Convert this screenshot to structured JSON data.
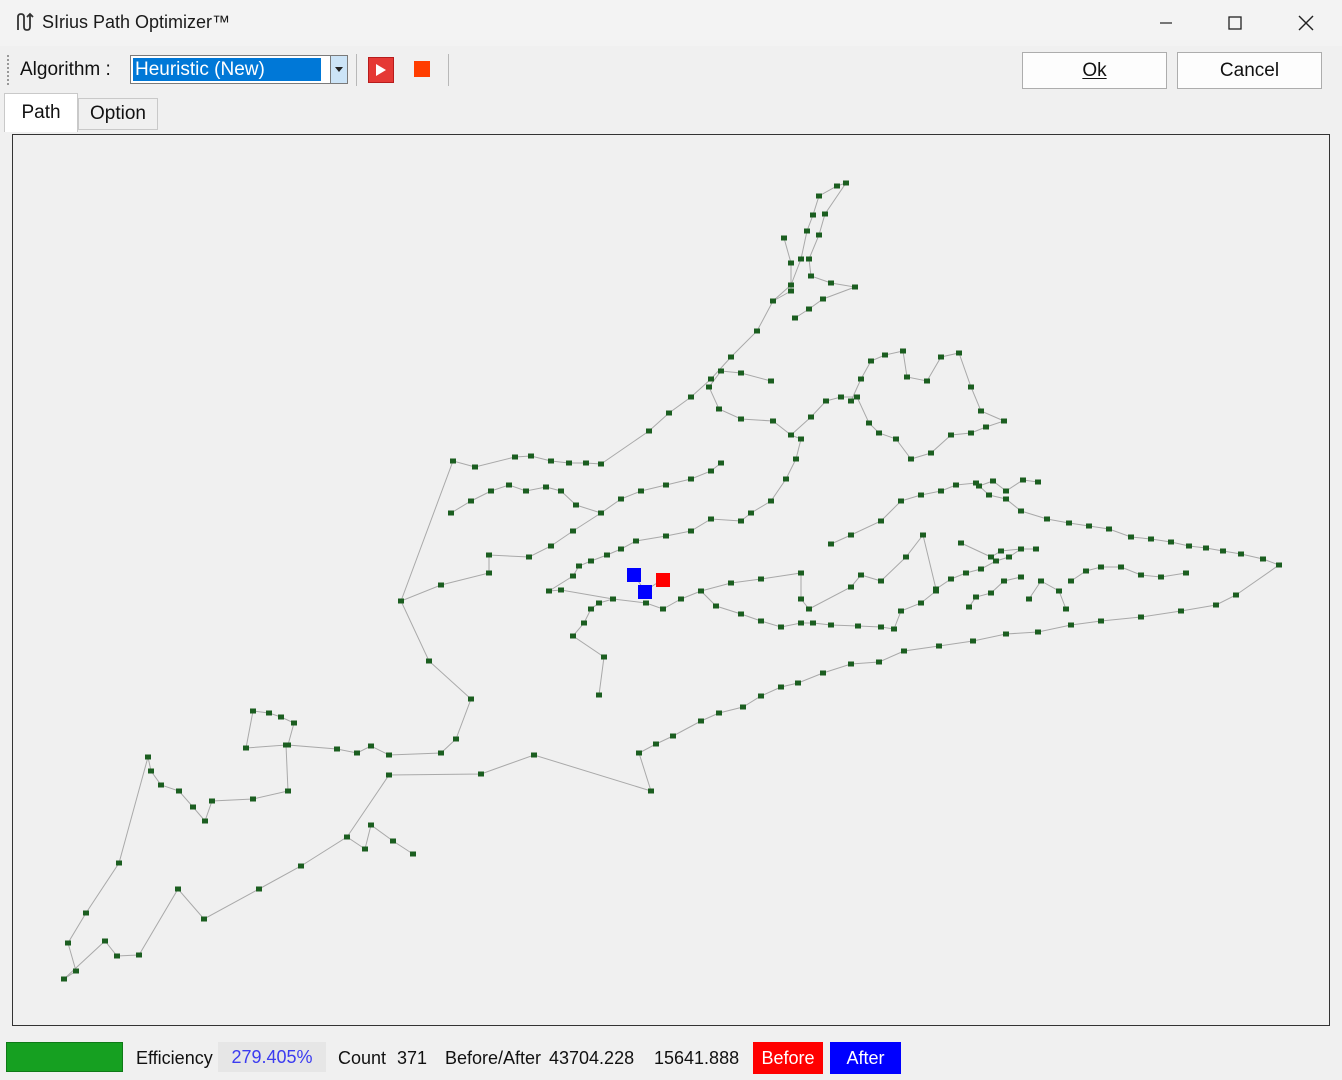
{
  "window": {
    "title": "SIrius Path Optimizer™"
  },
  "toolbar": {
    "algorithm_label": "Algorithm :",
    "algorithm_value": "Heuristic (New)",
    "ok_label": "Ok",
    "cancel_label": "Cancel"
  },
  "tabs": [
    {
      "label": "Path",
      "selected": true
    },
    {
      "label": "Option",
      "selected": false
    }
  ],
  "status": {
    "efficiency_label": "Efficiency",
    "efficiency_value": "279.405%",
    "count_label": "Count",
    "count_value": "371",
    "before_after_label": "Before/After",
    "before_value": "43704.228",
    "after_value": "15641.888",
    "before_button": "Before",
    "after_button": "After"
  },
  "colors": {
    "node": "#1b5e20",
    "path_line": "#a9a9a9",
    "start_marker": "#0000ff",
    "end_marker": "#ff0000",
    "progress": "#16a021",
    "accent": "#0078d7"
  },
  "icons": {
    "app": "path-optimizer-icon",
    "run": "play-icon",
    "stop": "stop-icon",
    "minimize": "minimize-icon",
    "maximize": "maximize-icon",
    "close": "close-icon"
  }
}
